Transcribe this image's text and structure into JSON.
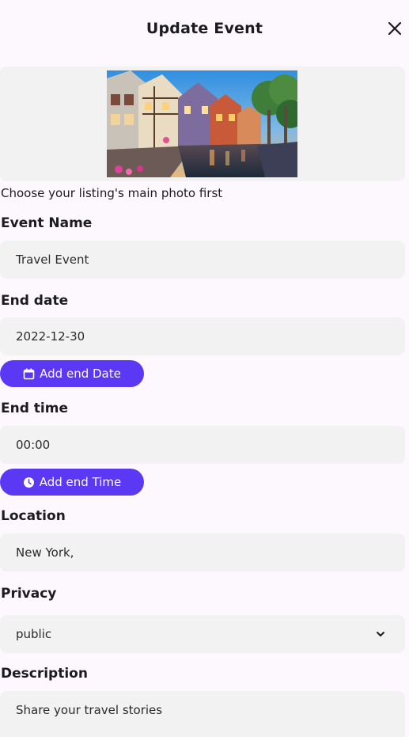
{
  "header": {
    "title": "Update Event",
    "close_icon": "close-icon"
  },
  "photo": {
    "hint": "Choose your listing's main photo first"
  },
  "event_name": {
    "label": "Event Name",
    "value": "Travel Event"
  },
  "end_date": {
    "label": "End date",
    "value": "2022-12-30",
    "button_label": "Add end Date",
    "button_icon": "calendar-icon"
  },
  "end_time": {
    "label": "End time",
    "value": "00:00",
    "button_label": "Add end Time",
    "button_icon": "clock-icon"
  },
  "location": {
    "label": "Location",
    "value": "New York,"
  },
  "privacy": {
    "label": "Privacy",
    "value": "public",
    "icon": "chevron-down-icon"
  },
  "description": {
    "label": "Description",
    "value": "Share your travel stories"
  },
  "colors": {
    "accent": "#5b38f3",
    "field_bg": "#f3f2f3",
    "page_bg": "#fdf8fd"
  }
}
